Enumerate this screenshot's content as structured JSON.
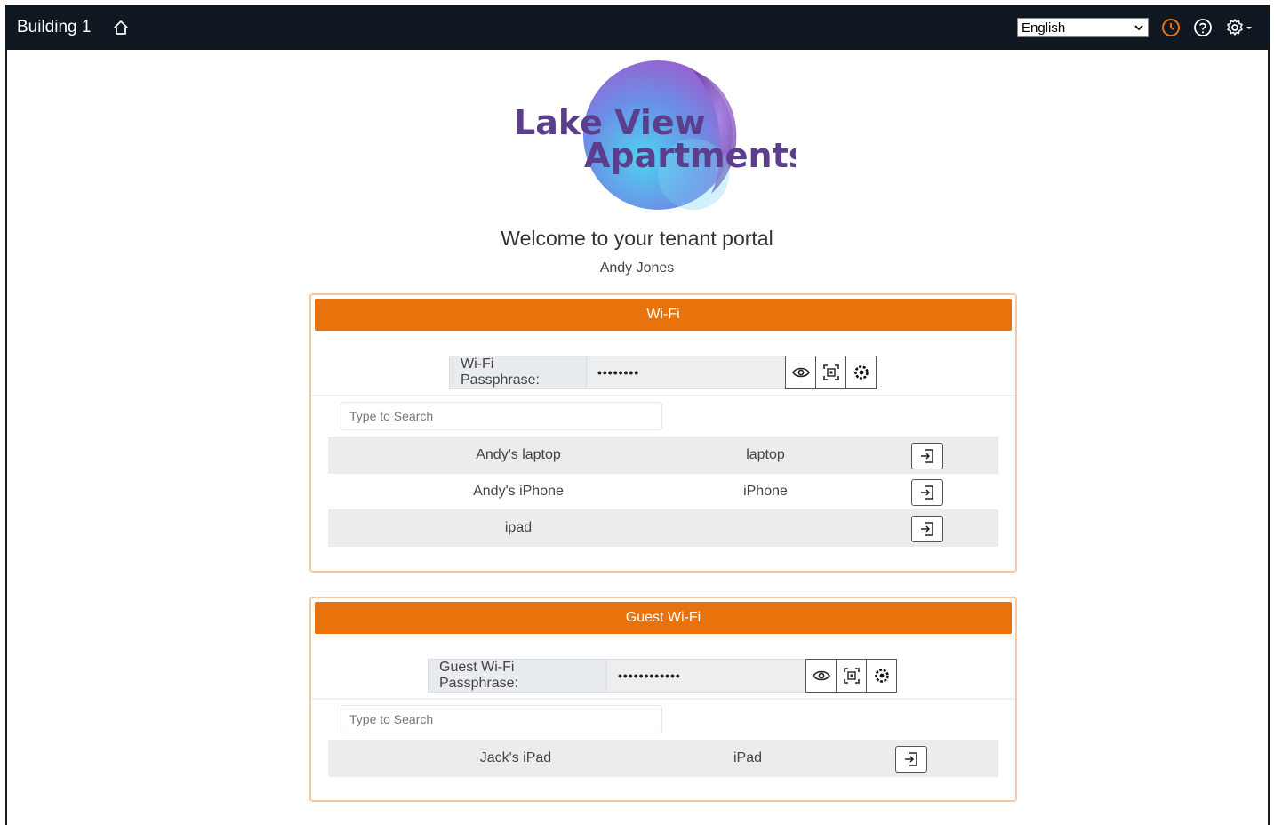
{
  "app": {
    "building": "Building 1",
    "language": "English"
  },
  "logo": {
    "line1": "Lake View",
    "line2": "Apartments"
  },
  "welcome": {
    "title": "Welcome to your tenant portal",
    "user": "Andy Jones"
  },
  "wifi": {
    "header": "Wi-Fi",
    "passphrase_label": "Wi-Fi Passphrase:",
    "passphrase_value": "••••••••",
    "search_placeholder": "Type to Search",
    "devices": [
      {
        "name": "Andy's laptop",
        "type": "laptop"
      },
      {
        "name": "Andy's iPhone",
        "type": "iPhone"
      },
      {
        "name": "ipad",
        "type": ""
      }
    ]
  },
  "guest_wifi": {
    "header": "Guest Wi-Fi",
    "passphrase_label": "Guest Wi-Fi Passphrase:",
    "passphrase_value": "••••••••••••",
    "search_placeholder": "Type to Search",
    "devices": [
      {
        "name": "Jack's iPad",
        "type": "iPad"
      }
    ]
  },
  "colors": {
    "topbar": "#0f1720",
    "accent": "#e8720c",
    "panel_border": "#f8c9a0",
    "logo_text": "#5b3f8c"
  }
}
